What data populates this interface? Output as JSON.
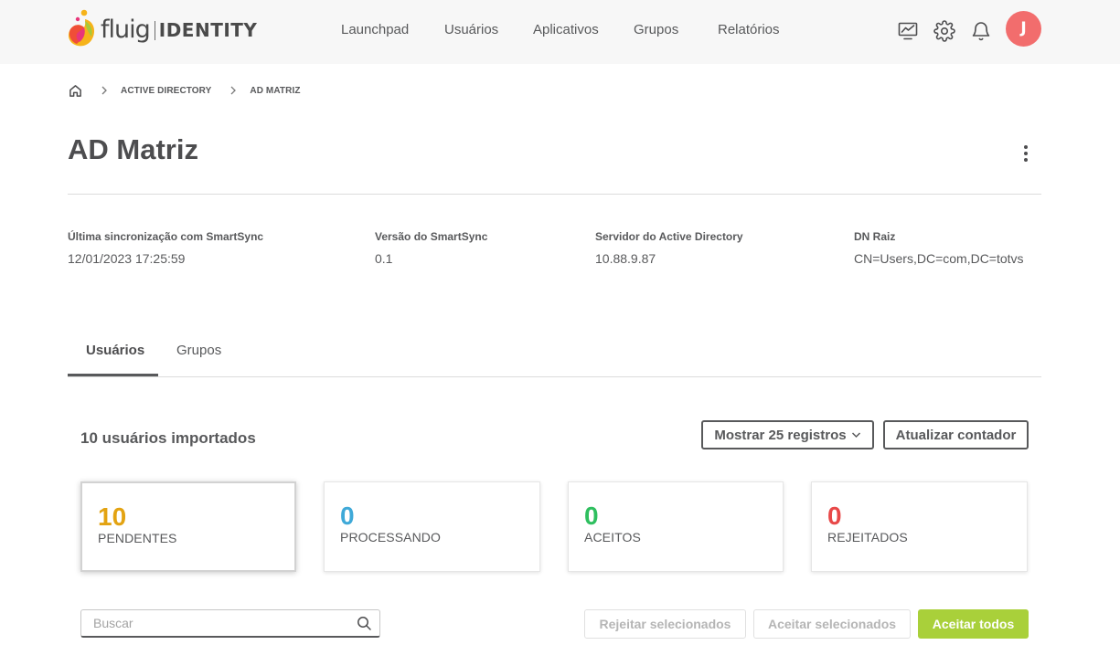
{
  "header": {
    "logo": {
      "brand": "fluig",
      "product": "IDENTITY"
    },
    "nav": [
      {
        "label": "Launchpad"
      },
      {
        "label": "Usuários"
      },
      {
        "label": "Aplicativos"
      },
      {
        "label": "Grupos"
      },
      {
        "label": "Relatórios"
      }
    ],
    "icons": [
      "monitor-chart-icon",
      "gear-icon",
      "bell-icon"
    ],
    "avatar_initial": "J",
    "avatar_color": "#f26d6d"
  },
  "breadcrumb": {
    "home_icon": "home-icon",
    "items": [
      {
        "label": "ACTIVE DIRECTORY"
      },
      {
        "label": "AD MATRIZ"
      }
    ]
  },
  "page": {
    "title": "AD Matriz",
    "menu_icon": "kebab-menu-icon"
  },
  "info": [
    {
      "label": "Última sincronização com SmartSync",
      "value": "12/01/2023 17:25:59"
    },
    {
      "label": "Versão do SmartSync",
      "value": "0.1"
    },
    {
      "label": "Servidor do Active Directory",
      "value": "10.88.9.87"
    },
    {
      "label": "DN Raiz",
      "value": "CN=Users,DC=com,DC=totvs"
    }
  ],
  "tabs": [
    {
      "label": "Usuários",
      "active": true
    },
    {
      "label": "Grupos",
      "active": false
    }
  ],
  "section": {
    "import_count": "10 usuários importados",
    "show_records": "Mostrar 25 registros",
    "refresh_counter": "Atualizar contador"
  },
  "cards": [
    {
      "value": "10",
      "label": "PENDENTES",
      "color": "#e3a312",
      "selected": true
    },
    {
      "value": "0",
      "label": "PROCESSANDO",
      "color": "#3fa9d8",
      "selected": false
    },
    {
      "value": "0",
      "label": "ACEITOS",
      "color": "#2fbf5f",
      "selected": false
    },
    {
      "value": "0",
      "label": "REJEITADOS",
      "color": "#e84848",
      "selected": false
    }
  ],
  "search": {
    "placeholder": "Buscar",
    "value": ""
  },
  "actions": {
    "reject_selected": "Rejeitar selecionados",
    "accept_selected": "Aceitar selecionados",
    "accept_all": "Aceitar todos",
    "accent": "#a9d03a"
  }
}
